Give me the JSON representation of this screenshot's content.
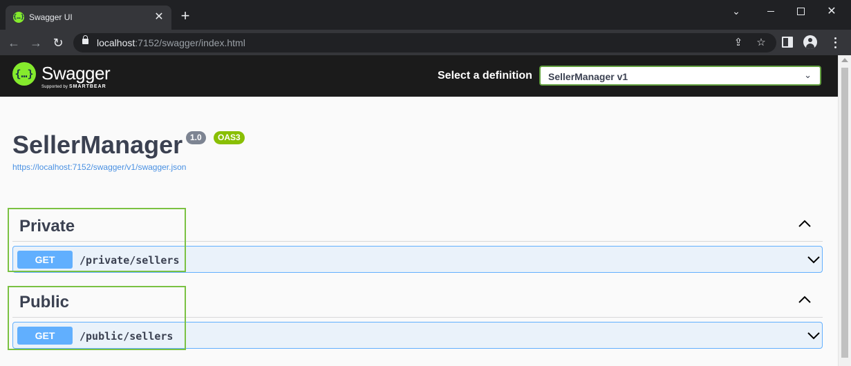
{
  "browser": {
    "tab_title": "Swagger UI",
    "tab_favicon": "{…}",
    "new_tab_label": "+",
    "url_host": "localhost",
    "url_rest": ":7152/swagger/index.html",
    "icons": [
      "back-arrow-icon",
      "forward-arrow-icon",
      "reload-icon",
      "lock-icon",
      "share-icon",
      "star-icon",
      "side-panel-icon",
      "profile-icon",
      "menu-icon"
    ]
  },
  "topbar": {
    "logo_glyph": "{…}",
    "logo_name": "Swagger",
    "logo_sub_prefix": "Supported by ",
    "logo_sub_brand": "SMARTBEAR",
    "definition_label": "Select a definition",
    "definition_selected": "SellerManager v1"
  },
  "info": {
    "title": "SellerManager",
    "version": "1.0",
    "oas": "OAS3",
    "spec_url": "https://localhost:7152/swagger/v1/swagger.json"
  },
  "tags": [
    {
      "name": "Private",
      "operations": [
        {
          "method": "GET",
          "path": "/private/sellers"
        }
      ]
    },
    {
      "name": "Public",
      "operations": [
        {
          "method": "GET",
          "path": "/public/sellers"
        }
      ]
    }
  ],
  "colors": {
    "swagger_green": "#85ea2d",
    "get_blue": "#61affe",
    "annotation_green": "#7ac142",
    "oas_badge": "#89bf04",
    "version_badge": "#7d8492"
  }
}
